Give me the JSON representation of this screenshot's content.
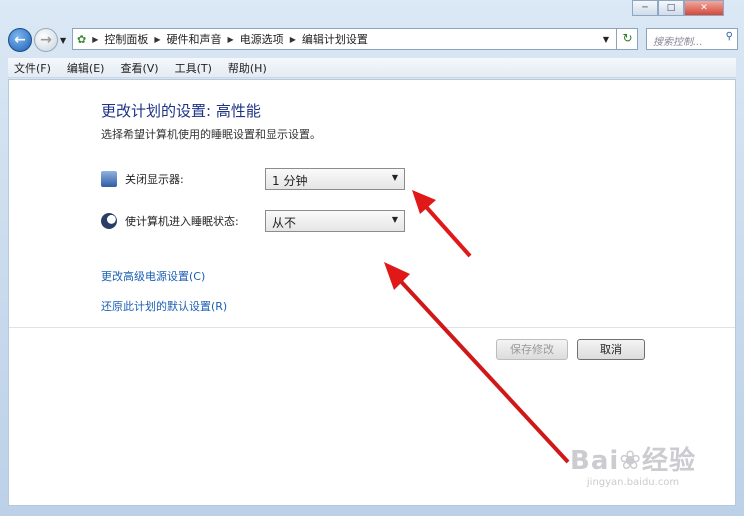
{
  "window": {
    "buttons": [
      "minimize",
      "maximize",
      "close"
    ]
  },
  "navigation": {
    "back_icon": "back-arrow-icon",
    "forward_icon": "forward-arrow-icon"
  },
  "breadcrumb": [
    "控制面板",
    "硬件和声音",
    "电源选项",
    "编辑计划设置"
  ],
  "search": {
    "placeholder": "搜索控制..."
  },
  "menu": [
    "文件(F)",
    "编辑(E)",
    "查看(V)",
    "工具(T)",
    "帮助(H)"
  ],
  "main": {
    "title": "更改计划的设置: 高性能",
    "subtitle": "选择希望计算机使用的睡眠设置和显示设置。",
    "settings": [
      {
        "label": "关闭显示器:",
        "value": "1 分钟",
        "icon": "monitor-icon"
      },
      {
        "label": "使计算机进入睡眠状态:",
        "value": "从不",
        "icon": "moon-icon"
      }
    ],
    "links": [
      "更改高级电源设置(C)",
      "还原此计划的默认设置(R)"
    ],
    "save_label": "保存修改",
    "cancel_label": "取消"
  },
  "annotation": {
    "arrow_color": "#e01818"
  },
  "watermark": {
    "brand": "Bai 经验",
    "url": "jingyan.baidu.com"
  }
}
